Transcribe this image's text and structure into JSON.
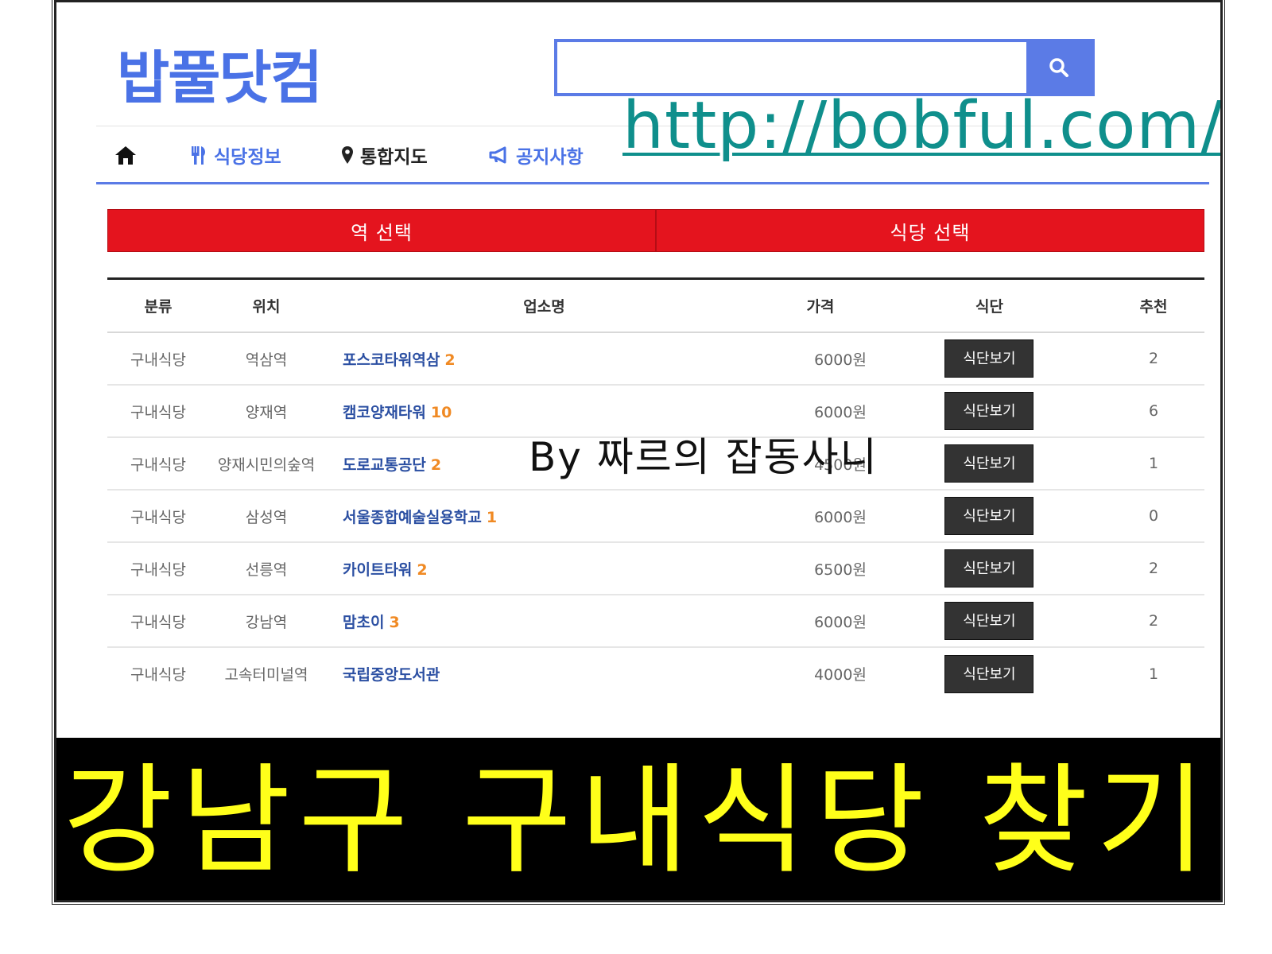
{
  "site": {
    "logo": "밥풀닷컴",
    "url_overlay": "http://bobful.com/"
  },
  "search": {
    "placeholder": "",
    "value": ""
  },
  "nav": {
    "items": [
      {
        "label": "",
        "icon": "home-icon"
      },
      {
        "label": "식당정보",
        "icon": "utensils-icon"
      },
      {
        "label": "통합지도",
        "icon": "map-marker-icon"
      },
      {
        "label": "공지사항",
        "icon": "megaphone-icon"
      }
    ]
  },
  "tabs": [
    {
      "label": "역 선택"
    },
    {
      "label": "식당 선택"
    }
  ],
  "table": {
    "headers": {
      "category": "분류",
      "location": "위치",
      "name": "업소명",
      "price": "가격",
      "menu": "식단",
      "recommend": "추천"
    },
    "rows": [
      {
        "category": "구내식당",
        "location": "역삼역",
        "name": "포스코타워역삼",
        "count": "2",
        "price": "6000원",
        "menu": "식단보기",
        "recommend": "2"
      },
      {
        "category": "구내식당",
        "location": "양재역",
        "name": "캠코양재타워",
        "count": "10",
        "price": "6000원",
        "menu": "식단보기",
        "recommend": "6"
      },
      {
        "category": "구내식당",
        "location": "양재시민의숲역",
        "name": "도로교통공단",
        "count": "2",
        "price": "4500원",
        "menu": "식단보기",
        "recommend": "1"
      },
      {
        "category": "구내식당",
        "location": "삼성역",
        "name": "서울종합예술실용학교",
        "count": "1",
        "price": "6000원",
        "menu": "식단보기",
        "recommend": "0"
      },
      {
        "category": "구내식당",
        "location": "선릉역",
        "name": "카이트타워",
        "count": "2",
        "price": "6500원",
        "menu": "식단보기",
        "recommend": "2"
      },
      {
        "category": "구내식당",
        "location": "강남역",
        "name": "맘초이",
        "count": "3",
        "price": "6000원",
        "menu": "식단보기",
        "recommend": "2"
      },
      {
        "category": "구내식당",
        "location": "고속터미널역",
        "name": "국립중앙도서관",
        "count": "",
        "price": "4000원",
        "menu": "식단보기",
        "recommend": "1"
      }
    ]
  },
  "watermark": "By 짜르의 잡동사니",
  "banner": "강남구 구내식당 찾기",
  "colors": {
    "brand": "#4a72e6",
    "tab_red": "#e4141e",
    "url_teal": "#0f8f8c",
    "banner_yellow": "#ffff1a",
    "count_orange": "#f08a24"
  }
}
